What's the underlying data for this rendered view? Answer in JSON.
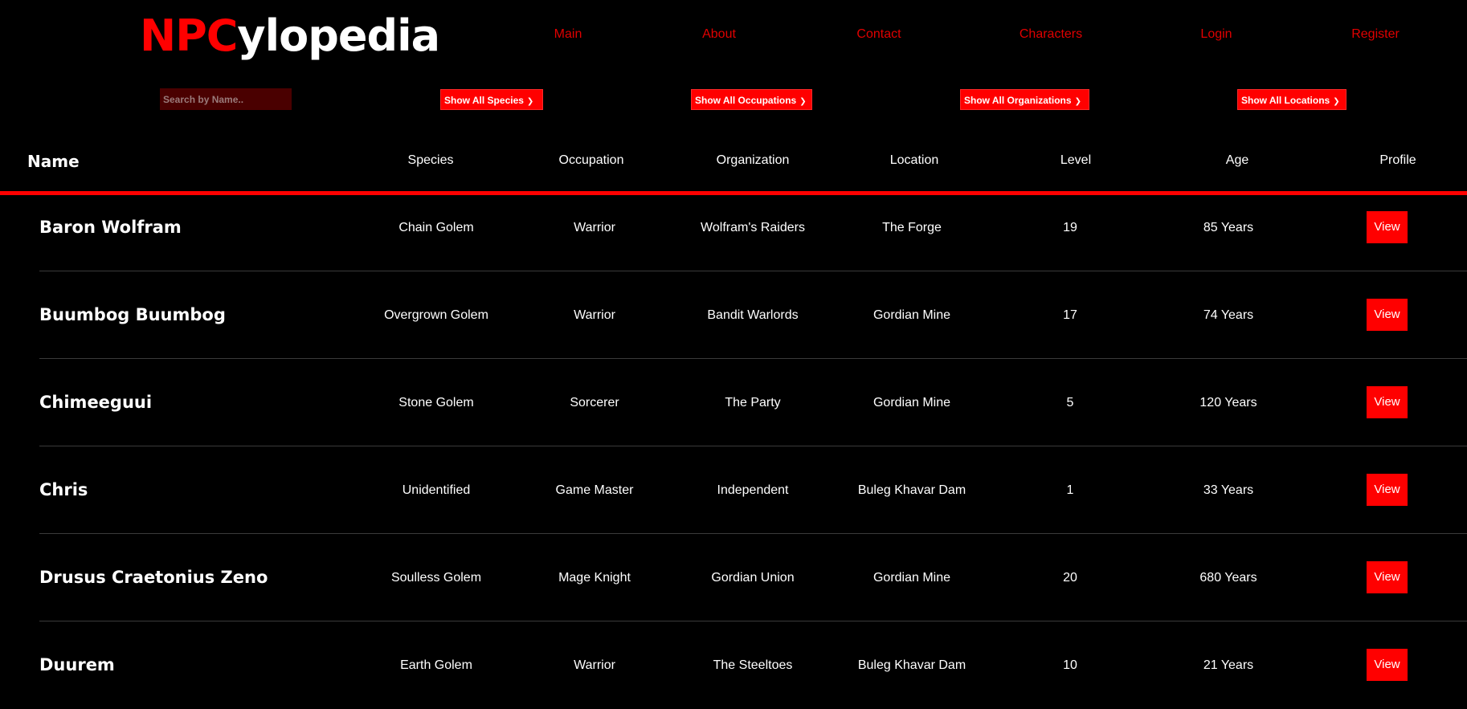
{
  "brand": {
    "logo_red": "NPC",
    "logo_white": "ylopedia"
  },
  "nav": [
    {
      "label": "Main"
    },
    {
      "label": "About"
    },
    {
      "label": "Contact"
    },
    {
      "label": "Characters"
    },
    {
      "label": "Login"
    },
    {
      "label": "Register"
    }
  ],
  "colors": {
    "accent": "#ff0000",
    "background": "#000000",
    "search_bg": "#4a0000",
    "text": "#ffffff"
  },
  "search": {
    "placeholder": "Search by Name..",
    "value": ""
  },
  "filters": {
    "species": "Show All Species",
    "occupations": "Show All Occupations",
    "organizations": "Show All Organizations",
    "locations": "Show All Locations",
    "icon": "chevron-down-icon"
  },
  "table": {
    "columns": {
      "name": "Name",
      "species": "Species",
      "occupation": "Occupation",
      "organization": "Organization",
      "location": "Location",
      "level": "Level",
      "age": "Age",
      "profile": "Profile"
    },
    "rows": [
      {
        "name": "Baron Wolfram",
        "species": "Chain Golem",
        "occupation": "Warrior",
        "organization": "Wolfram's Raiders",
        "location": "The Forge",
        "level": "19",
        "age": "85 Years",
        "action": "View"
      },
      {
        "name": "Buumbog Buumbog",
        "species": "Overgrown Golem",
        "occupation": "Warrior",
        "organization": "Bandit Warlords",
        "location": "Gordian Mine",
        "level": "17",
        "age": "74 Years",
        "action": "View"
      },
      {
        "name": "Chimeeguui",
        "species": "Stone Golem",
        "occupation": "Sorcerer",
        "organization": "The Party",
        "location": "Gordian Mine",
        "level": "5",
        "age": "120 Years",
        "action": "View"
      },
      {
        "name": "Chris",
        "species": "Unidentified",
        "occupation": "Game Master",
        "organization": "Independent",
        "location": "Buleg Khavar Dam",
        "level": "1",
        "age": "33 Years",
        "action": "View"
      },
      {
        "name": "Drusus Craetonius Zeno",
        "species": "Soulless Golem",
        "occupation": "Mage Knight",
        "organization": "Gordian Union",
        "location": "Gordian Mine",
        "level": "20",
        "age": "680 Years",
        "action": "View"
      },
      {
        "name": "Duurem",
        "species": "Earth Golem",
        "occupation": "Warrior",
        "organization": "The Steeltoes",
        "location": "Buleg Khavar Dam",
        "level": "10",
        "age": "21 Years",
        "action": "View"
      }
    ]
  }
}
